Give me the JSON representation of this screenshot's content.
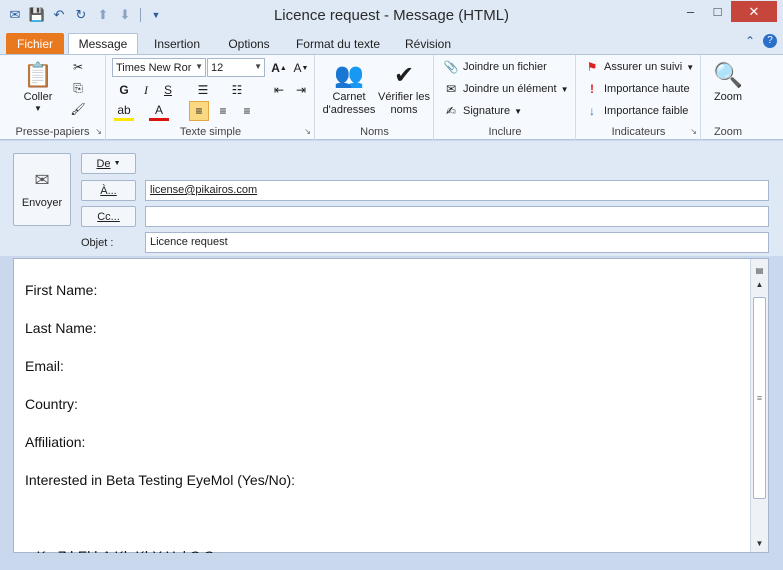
{
  "window": {
    "title": "Licence request - Message (HTML)",
    "minimize": "–",
    "maximize": "□",
    "close": "✕"
  },
  "tabs": {
    "file": "Fichier",
    "items": [
      "Message",
      "Insertion",
      "Options",
      "Format du texte",
      "Révision"
    ]
  },
  "ribbon": {
    "clipboard": {
      "paste": "Coller",
      "label": "Presse-papiers"
    },
    "text": {
      "font": "Times New Ror",
      "size": "12",
      "bold": "G",
      "italic": "I",
      "underline": "S",
      "label": "Texte simple"
    },
    "names": {
      "address_book": "Carnet d'adresses",
      "check_names": "Vérifier les noms",
      "label": "Noms"
    },
    "include": {
      "attach_file": "Joindre un fichier",
      "attach_item": "Joindre un élément",
      "signature": "Signature",
      "label": "Inclure"
    },
    "tags": {
      "follow_up": "Assurer un suivi",
      "high": "Importance haute",
      "low": "Importance faible",
      "label": "Indicateurs"
    },
    "zoom": {
      "zoom": "Zoom",
      "label": "Zoom"
    }
  },
  "header": {
    "send": "Envoyer",
    "from": "De",
    "to_btn": "À...",
    "cc_btn": "Cc...",
    "subject_label": "Objet :",
    "to_value": "license@pikairos.com",
    "cc_value": "",
    "subject_value": "Licence request"
  },
  "body": {
    "lines": [
      "First Name:",
      "Last Name:",
      "Email:",
      "Country:",
      "Affiliation:",
      "Interested in Beta Testing EyeMol (Yes/No):",
      "",
      "g K gZ hEl hA Kh  KhY Hzl C  Q=="
    ]
  },
  "colors": {
    "file_tab": "#e9791f",
    "close": "#c7463b",
    "highlight": "#fbd983"
  }
}
